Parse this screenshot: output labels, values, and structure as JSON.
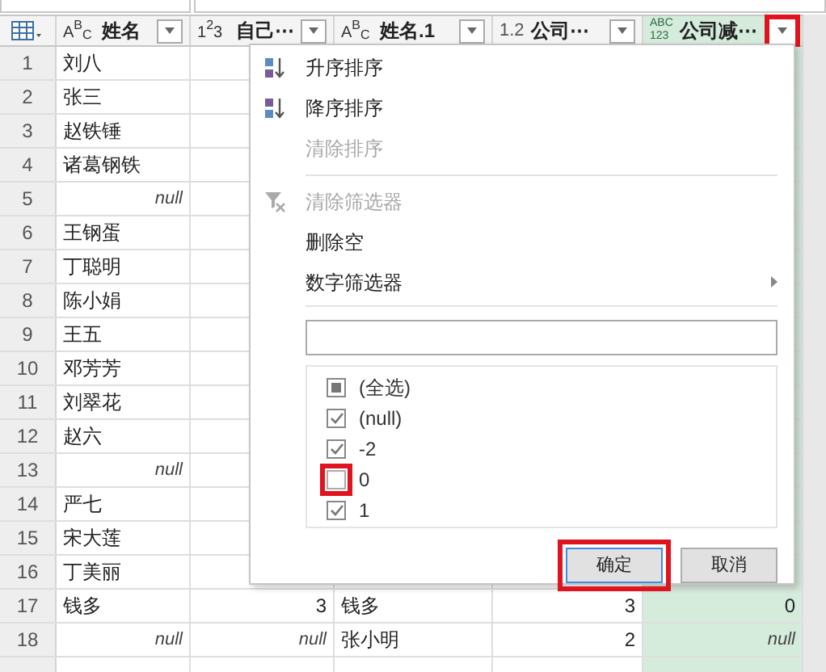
{
  "columns": [
    {
      "kind": "text",
      "type_label": [
        "A",
        "B",
        "C"
      ],
      "title": "姓名",
      "selected": false,
      "highlighted": false
    },
    {
      "kind": "whole",
      "type_label": [
        "1",
        "2",
        "3"
      ],
      "title": "自己⋯",
      "selected": false,
      "highlighted": false
    },
    {
      "kind": "text",
      "type_label": [
        "A",
        "B",
        "C"
      ],
      "title": "姓名.1",
      "selected": false,
      "highlighted": false
    },
    {
      "kind": "decimal",
      "type_label": [
        "1.2"
      ],
      "title": "公司⋯",
      "selected": false,
      "highlighted": false
    },
    {
      "kind": "any",
      "type_label": [
        "ABC",
        "123"
      ],
      "title": "公司减⋯",
      "selected": true,
      "highlighted": true
    }
  ],
  "rows": [
    {
      "number": "1",
      "cells": [
        {
          "text": "刘八",
          "null": false
        }
      ]
    },
    {
      "number": "2",
      "cells": [
        {
          "text": "张三",
          "null": false
        }
      ]
    },
    {
      "number": "3",
      "cells": [
        {
          "text": "赵铁锤",
          "null": false
        }
      ]
    },
    {
      "number": "4",
      "cells": [
        {
          "text": "诸葛钢铁",
          "null": false
        }
      ]
    },
    {
      "number": "5",
      "cells": [
        {
          "text": "null",
          "null": true
        }
      ]
    },
    {
      "number": "6",
      "cells": [
        {
          "text": "王钢蛋",
          "null": false
        }
      ]
    },
    {
      "number": "7",
      "cells": [
        {
          "text": "丁聪明",
          "null": false
        }
      ]
    },
    {
      "number": "8",
      "cells": [
        {
          "text": "陈小娟",
          "null": false
        }
      ]
    },
    {
      "number": "9",
      "cells": [
        {
          "text": "王五",
          "null": false
        }
      ]
    },
    {
      "number": "10",
      "cells": [
        {
          "text": "邓芳芳",
          "null": false
        }
      ]
    },
    {
      "number": "11",
      "cells": [
        {
          "text": "刘翠花",
          "null": false
        }
      ]
    },
    {
      "number": "12",
      "cells": [
        {
          "text": "赵六",
          "null": false
        }
      ]
    },
    {
      "number": "13",
      "cells": [
        {
          "text": "null",
          "null": true
        }
      ]
    },
    {
      "number": "14",
      "cells": [
        {
          "text": "严七",
          "null": false
        }
      ]
    },
    {
      "number": "15",
      "cells": [
        {
          "text": "宋大莲",
          "null": false
        }
      ]
    },
    {
      "number": "16",
      "cells": [
        {
          "text": "丁美丽",
          "null": false
        }
      ]
    },
    {
      "number": "17",
      "cells": [
        {
          "text": "钱多",
          "null": false
        },
        {
          "text": "3",
          "null": false
        },
        {
          "text": "钱多",
          "null": false
        },
        {
          "text": "3",
          "null": false
        },
        {
          "text": "0",
          "null": false
        }
      ]
    },
    {
      "number": "18",
      "cells": [
        {
          "text": "null",
          "null": true
        },
        {
          "text": "null",
          "null": true
        },
        {
          "text": "张小明",
          "null": false
        },
        {
          "text": "2",
          "null": false
        },
        {
          "text": "null",
          "null": true
        }
      ]
    }
  ],
  "filter_menu": {
    "items": [
      {
        "kind": "sort-ascending",
        "label": "升序排序",
        "disabled": false
      },
      {
        "kind": "sort-descending",
        "label": "降序排序",
        "disabled": false
      },
      {
        "kind": "plain",
        "label": "清除排序",
        "disabled": true
      },
      {
        "kind": "separator"
      },
      {
        "kind": "clear-filter",
        "label": "清除筛选器",
        "disabled": true
      },
      {
        "kind": "plain",
        "label": "删除空",
        "disabled": false
      },
      {
        "kind": "submenu",
        "label": "数字筛选器",
        "disabled": false
      }
    ],
    "values": [
      {
        "label": "(全选)",
        "checked": true,
        "indeterminate": true,
        "highlighted": false
      },
      {
        "label": "(null)",
        "checked": true,
        "indeterminate": false,
        "highlighted": false
      },
      {
        "label": "-2",
        "checked": true,
        "indeterminate": false,
        "highlighted": false
      },
      {
        "label": "0",
        "checked": false,
        "indeterminate": false,
        "highlighted": true
      },
      {
        "label": "1",
        "checked": true,
        "indeterminate": false,
        "highlighted": false
      }
    ],
    "buttons": [
      {
        "label": "确定",
        "highlighted": true
      },
      {
        "label": "取消",
        "highlighted": false
      }
    ]
  }
}
